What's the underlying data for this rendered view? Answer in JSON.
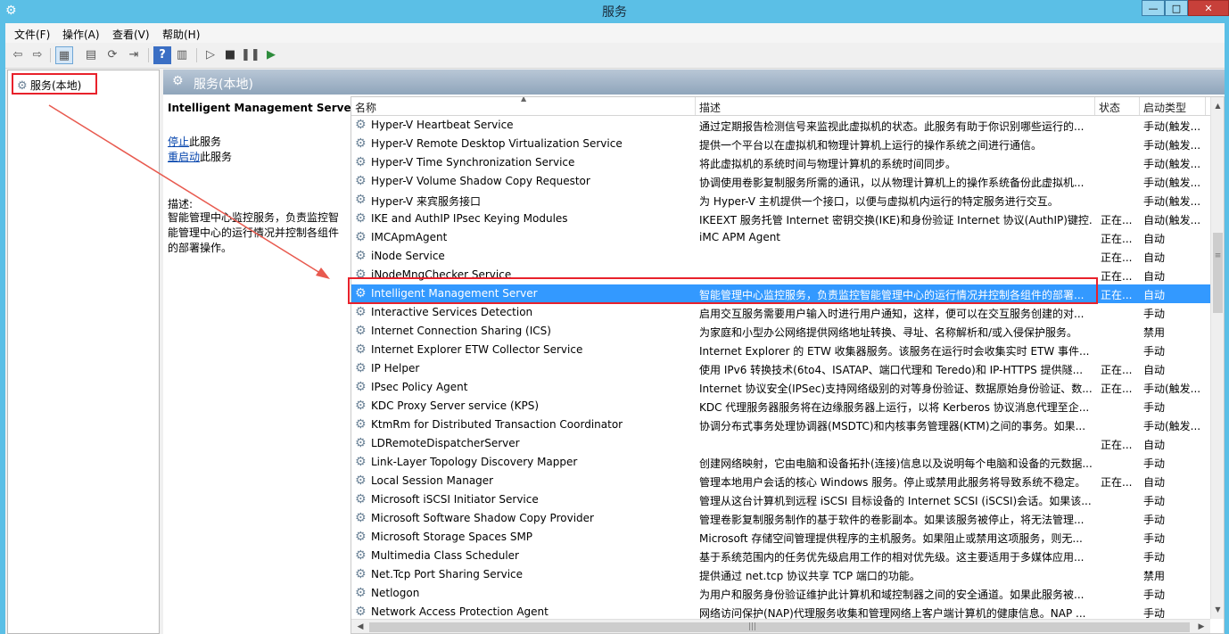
{
  "window": {
    "title": "服务",
    "controls": {
      "minimize": "—",
      "maximize": "□",
      "close": "✕"
    }
  },
  "menu": [
    "文件(F)",
    "操作(A)",
    "查看(V)",
    "帮助(H)"
  ],
  "toolbar": {
    "icons": [
      "back-icon",
      "forward-icon",
      "show-hide-tree-icon",
      "properties-icon",
      "refresh-icon",
      "export-icon",
      "help-icon",
      "view-icon",
      "start-icon",
      "stop-icon",
      "pause-icon",
      "restart-icon"
    ]
  },
  "tree": {
    "root": "服务(本地)"
  },
  "pane": {
    "header": "服务(本地)"
  },
  "detail": {
    "title": "Intelligent Management Server",
    "stop_link": "停止",
    "stop_suffix": "此服务",
    "restart_link": "重启动",
    "restart_suffix": "此服务",
    "desc_label": "描述:",
    "desc": "智能管理中心监控服务，负责监控智能管理中心的运行情况并控制各组件的部署操作。"
  },
  "columns": [
    "名称",
    "描述",
    "状态",
    "启动类型"
  ],
  "services": [
    {
      "name": "Hyper-V Heartbeat Service",
      "desc": "通过定期报告检测信号来监视此虚拟机的状态。此服务有助于你识别哪些运行的...",
      "status": "",
      "startup": "手动(触发..."
    },
    {
      "name": "Hyper-V Remote Desktop Virtualization Service",
      "desc": "提供一个平台以在虚拟机和物理计算机上运行的操作系统之间进行通信。",
      "status": "",
      "startup": "手动(触发..."
    },
    {
      "name": "Hyper-V Time Synchronization Service",
      "desc": "将此虚拟机的系统时间与物理计算机的系统时间同步。",
      "status": "",
      "startup": "手动(触发..."
    },
    {
      "name": "Hyper-V Volume Shadow Copy Requestor",
      "desc": "协调使用卷影复制服务所需的通讯，以从物理计算机上的操作系统备份此虚拟机...",
      "status": "",
      "startup": "手动(触发..."
    },
    {
      "name": "Hyper-V 来宾服务接口",
      "desc": "为 Hyper-V 主机提供一个接口，以便与虚拟机内运行的特定服务进行交互。",
      "status": "",
      "startup": "手动(触发..."
    },
    {
      "name": "IKE and AuthIP IPsec Keying Modules",
      "desc": "IKEEXT 服务托管 Internet 密钥交换(IKE)和身份验证 Internet 协议(AuthIP)键控...",
      "status": "正在...",
      "startup": "自动(触发..."
    },
    {
      "name": "IMCApmAgent",
      "desc": "iMC APM Agent",
      "status": "正在...",
      "startup": "自动"
    },
    {
      "name": "iNode Service",
      "desc": "",
      "status": "正在...",
      "startup": "自动"
    },
    {
      "name": "iNodeMngChecker Service",
      "desc": "",
      "status": "正在...",
      "startup": "自动"
    },
    {
      "name": "Intelligent Management Server",
      "desc": "智能管理中心监控服务，负责监控智能管理中心的运行情况并控制各组件的部署...",
      "status": "正在...",
      "startup": "自动",
      "selected": true
    },
    {
      "name": "Interactive Services Detection",
      "desc": "启用交互服务需要用户输入时进行用户通知，这样，便可以在交互服务创建的对...",
      "status": "",
      "startup": "手动"
    },
    {
      "name": "Internet Connection Sharing (ICS)",
      "desc": "为家庭和小型办公网络提供网络地址转换、寻址、名称解析和/或入侵保护服务。",
      "status": "",
      "startup": "禁用"
    },
    {
      "name": "Internet Explorer ETW Collector Service",
      "desc": "Internet Explorer 的 ETW 收集器服务。该服务在运行时会收集实时 ETW 事件...",
      "status": "",
      "startup": "手动"
    },
    {
      "name": "IP Helper",
      "desc": "使用 IPv6 转换技术(6to4、ISATAP、端口代理和 Teredo)和 IP-HTTPS 提供隧...",
      "status": "正在...",
      "startup": "自动"
    },
    {
      "name": "IPsec Policy Agent",
      "desc": "Internet 协议安全(IPSec)支持网络级别的对等身份验证、数据原始身份验证、数...",
      "status": "正在...",
      "startup": "手动(触发..."
    },
    {
      "name": "KDC Proxy Server service (KPS)",
      "desc": "KDC 代理服务器服务将在边缘服务器上运行，以将 Kerberos 协议消息代理至企...",
      "status": "",
      "startup": "手动"
    },
    {
      "name": "KtmRm for Distributed Transaction Coordinator",
      "desc": "协调分布式事务处理协调器(MSDTC)和内核事务管理器(KTM)之间的事务。如果...",
      "status": "",
      "startup": "手动(触发..."
    },
    {
      "name": "LDRemoteDispatcherServer",
      "desc": "",
      "status": "正在...",
      "startup": "自动"
    },
    {
      "name": "Link-Layer Topology Discovery Mapper",
      "desc": "创建网络映射，它由电脑和设备拓扑(连接)信息以及说明每个电脑和设备的元数据...",
      "status": "",
      "startup": "手动"
    },
    {
      "name": "Local Session Manager",
      "desc": "管理本地用户会话的核心 Windows 服务。停止或禁用此服务将导致系统不稳定。",
      "status": "正在...",
      "startup": "自动"
    },
    {
      "name": "Microsoft iSCSI Initiator Service",
      "desc": "管理从这台计算机到远程 iSCSI 目标设备的 Internet SCSI (iSCSI)会话。如果该...",
      "status": "",
      "startup": "手动"
    },
    {
      "name": "Microsoft Software Shadow Copy Provider",
      "desc": "管理卷影复制服务制作的基于软件的卷影副本。如果该服务被停止，将无法管理...",
      "status": "",
      "startup": "手动"
    },
    {
      "name": "Microsoft Storage Spaces SMP",
      "desc": "Microsoft 存储空间管理提供程序的主机服务。如果阻止或禁用这项服务，则无...",
      "status": "",
      "startup": "手动"
    },
    {
      "name": "Multimedia Class Scheduler",
      "desc": "基于系统范围内的任务优先级启用工作的相对优先级。这主要适用于多媒体应用...",
      "status": "",
      "startup": "手动"
    },
    {
      "name": "Net.Tcp Port Sharing Service",
      "desc": "提供通过 net.tcp 协议共享 TCP 端口的功能。",
      "status": "",
      "startup": "禁用"
    },
    {
      "name": "Netlogon",
      "desc": "为用户和服务身份验证维护此计算机和域控制器之间的安全通道。如果此服务被...",
      "status": "",
      "startup": "手动"
    },
    {
      "name": "Network Access Protection Agent",
      "desc": "网络访问保护(NAP)代理服务收集和管理网络上客户端计算机的健康信息。NAP ...",
      "status": "",
      "startup": "手动"
    }
  ]
}
